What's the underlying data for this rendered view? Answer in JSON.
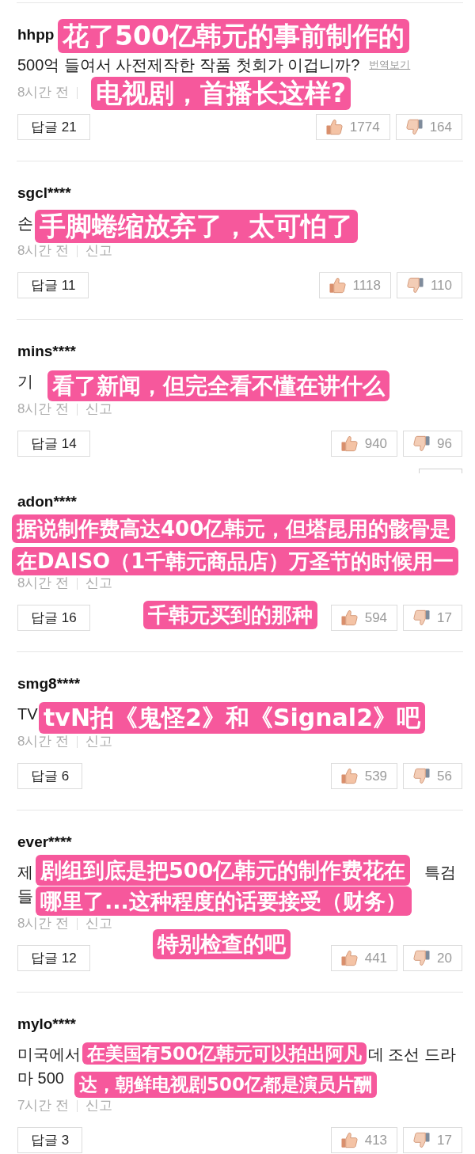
{
  "comments": [
    {
      "username": "hhpp",
      "body_lines": [
        [
          "500억 들여서 사전제작한 작품 첫회가 이겁니까?"
        ]
      ],
      "translate_link": "번역보기",
      "time": "8시간 전",
      "reply_button": "답글 21",
      "likes": "1774",
      "dislikes": "164",
      "cropped_button_below": false,
      "subtitles": [
        "花了500亿韩元的事前制作的",
        "电视剧，首播长这样?"
      ]
    },
    {
      "username": "sgcl****",
      "body_lines": [
        [
          "손"
        ]
      ],
      "time": "8시간 전",
      "report": "신고",
      "reply_button": "답글 11",
      "likes": "1118",
      "dislikes": "110",
      "cropped_button_below": false,
      "subtitles": [
        "手脚蜷缩放弃了，太可怕了"
      ]
    },
    {
      "username": "mins****",
      "body_lines": [
        [
          "기"
        ]
      ],
      "time": "8시간 전",
      "report": "신고",
      "reply_button": "답글 14",
      "likes": "940",
      "dislikes": "96",
      "cropped_button_below": true,
      "subtitles": [
        "看了新闻，但完全看不懂在讲什么"
      ]
    },
    {
      "username": "adon****",
      "time": "8시간 전",
      "report": "신고",
      "reply_button": "답글 16",
      "likes": "594",
      "dislikes": "17",
      "cropped_button_below": false,
      "subtitles": [
        "据说制作费高达400亿韩元，但塔昆用的骸骨是",
        "在DAISO（1千韩元商品店）万圣节的时候用一",
        "千韩元买到的那种"
      ]
    },
    {
      "username": "smg8****",
      "body_lines": [
        [
          "TV"
        ]
      ],
      "time": "8시간 전",
      "report": "신고",
      "reply_button": "답글 6",
      "likes": "539",
      "dislikes": "56",
      "cropped_button_below": false,
      "subtitles": [
        "tvN拍《鬼怪2》和《Signal2》吧"
      ]
    },
    {
      "username": "ever****",
      "body_lines": [
        [
          "제",
          "특검"
        ],
        [
          "들"
        ]
      ],
      "time": "8시간 전",
      "report": "신고",
      "reply_button": "답글 12",
      "likes": "441",
      "dislikes": "20",
      "cropped_button_below": false,
      "subtitles": [
        "剧组到底是把500亿韩元的制作费花在",
        "哪里了...这种程度的话要接受（财务）",
        "特别检查的吧"
      ]
    },
    {
      "username": "mylo****",
      "body_lines": [
        [
          "미국에서",
          "데 조선 드라"
        ],
        [
          "마 500"
        ]
      ],
      "time": "7시간 전",
      "report": "신고",
      "reply_button": "답글 3",
      "likes": "413",
      "dislikes": "17",
      "cropped_button_below": false,
      "subtitles": [
        "在美国有500亿韩元可以拍出阿凡",
        "达，朝鲜电视剧500亿都是演员片酬"
      ]
    }
  ]
}
